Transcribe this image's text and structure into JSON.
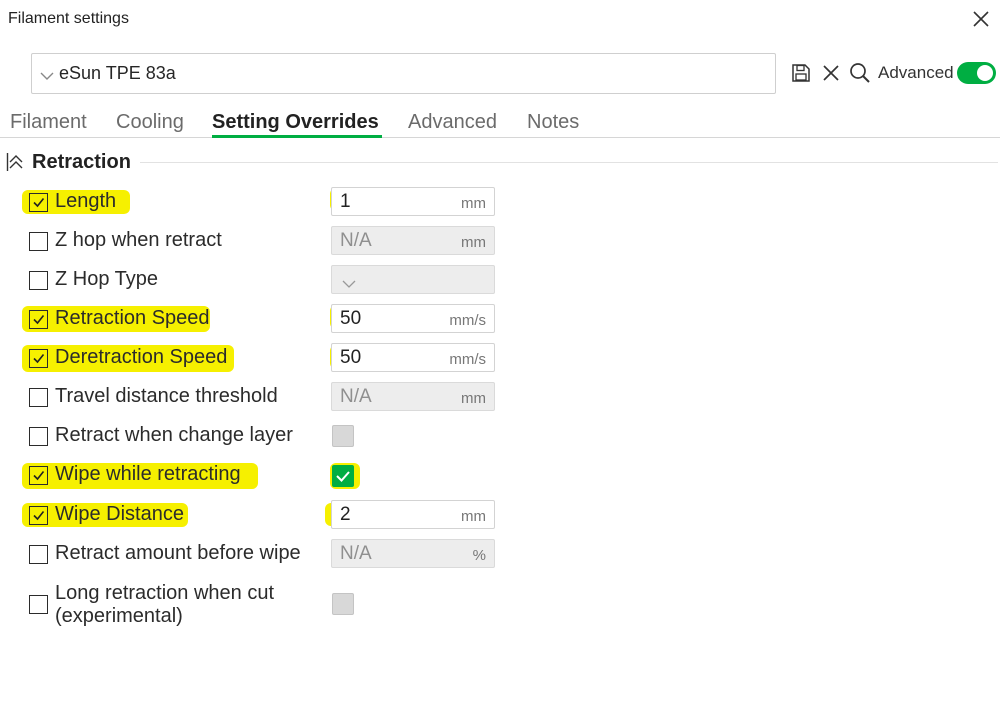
{
  "window": {
    "title": "Filament settings"
  },
  "preset": {
    "name": "eSun TPE 83a"
  },
  "toolbar": {
    "advanced_label": "Advanced",
    "advanced_enabled": true
  },
  "colors": {
    "accent": "#00ae42",
    "highlight": "#f6f000"
  },
  "tabs": [
    {
      "label": "Filament",
      "active": false
    },
    {
      "label": "Cooling",
      "active": false
    },
    {
      "label": "Setting Overrides",
      "active": true
    },
    {
      "label": "Advanced",
      "active": false
    },
    {
      "label": "Notes",
      "active": false
    }
  ],
  "section": {
    "title": "Retraction"
  },
  "rows": [
    {
      "label": "Length",
      "checked": true,
      "highlighted": true,
      "control": "input",
      "value": "1",
      "unit": "mm",
      "value_highlighted": true
    },
    {
      "label": "Z hop when retract",
      "checked": false,
      "highlighted": false,
      "control": "input",
      "value": "N/A",
      "unit": "mm",
      "disabled": true
    },
    {
      "label": "Z Hop Type",
      "checked": false,
      "highlighted": false,
      "control": "select",
      "value": "",
      "disabled": true
    },
    {
      "label": "Retraction Speed",
      "checked": true,
      "highlighted": true,
      "control": "input",
      "value": "50",
      "unit": "mm/s",
      "value_highlighted": true
    },
    {
      "label": "Deretraction Speed",
      "checked": true,
      "highlighted": true,
      "control": "input",
      "value": "50",
      "unit": "mm/s",
      "value_highlighted": true
    },
    {
      "label": "Travel distance threshold",
      "checked": false,
      "highlighted": false,
      "control": "input",
      "value": "N/A",
      "unit": "mm",
      "disabled": true
    },
    {
      "label": "Retract when change layer",
      "checked": false,
      "highlighted": false,
      "control": "checkbox",
      "value_checked": false
    },
    {
      "label": "Wipe while retracting",
      "checked": true,
      "highlighted": true,
      "control": "checkbox",
      "value_checked": true,
      "value_highlighted": true
    },
    {
      "label": "Wipe Distance",
      "checked": true,
      "highlighted": true,
      "control": "input",
      "value": "2",
      "unit": "mm",
      "value_highlighted": true
    },
    {
      "label": "Retract amount before wipe",
      "checked": false,
      "highlighted": false,
      "control": "input",
      "value": "N/A",
      "unit": "%",
      "disabled": true
    },
    {
      "label": "Long retraction when cut (experimental)",
      "checked": false,
      "highlighted": false,
      "control": "checkbox",
      "value_checked": false
    }
  ]
}
